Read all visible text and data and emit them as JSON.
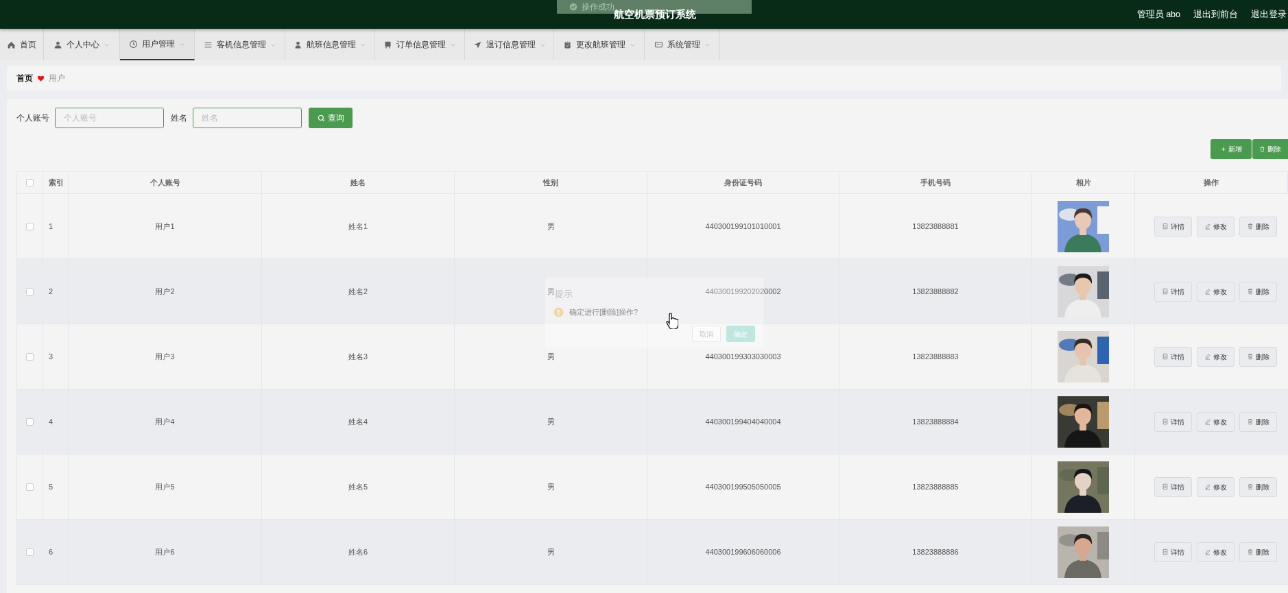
{
  "header": {
    "title": "航空机票预订系统",
    "user": "管理员 abo",
    "links": [
      "退出到前台",
      "退出登录"
    ]
  },
  "toast": {
    "text": "操作成功"
  },
  "nav": [
    {
      "label": "首页",
      "selected": false,
      "has_menu": false
    },
    {
      "label": "个人中心",
      "selected": false,
      "has_menu": true
    },
    {
      "label": "用户管理",
      "selected": true,
      "has_menu": true
    },
    {
      "label": "客机信息管理",
      "selected": false,
      "has_menu": true
    },
    {
      "label": "航班信息管理",
      "selected": false,
      "has_menu": true
    },
    {
      "label": "订单信息管理",
      "selected": false,
      "has_menu": true
    },
    {
      "label": "退订信息管理",
      "selected": false,
      "has_menu": true
    },
    {
      "label": "更改航班管理",
      "selected": false,
      "has_menu": true
    },
    {
      "label": "系统管理",
      "selected": false,
      "has_menu": true
    }
  ],
  "breadcrumb": [
    "首页",
    "用户"
  ],
  "search": {
    "fields": [
      {
        "label": "个人账号",
        "placeholder": "个人账号"
      },
      {
        "label": "姓名",
        "placeholder": "姓名"
      }
    ],
    "button": "查询"
  },
  "actions": [
    "新增",
    "删除"
  ],
  "table": {
    "select_all": {
      "checked": false
    },
    "columns": [
      "索引",
      "个人账号",
      "姓名",
      "性别",
      "身份证号码",
      "手机号码",
      "相片",
      "操作"
    ],
    "rows": [
      {
        "checked": false,
        "cells": [
          "1",
          "用户1",
          "姓名1",
          "男",
          "440300199101010001",
          "13823888881"
        ],
        "actions": [
          "详情",
          "修改",
          "删除"
        ]
      },
      {
        "checked": false,
        "cells": [
          "2",
          "用户2",
          "姓名2",
          "男",
          "440300199202020002",
          "13823888882"
        ],
        "actions": [
          "详情",
          "修改",
          "删除"
        ]
      },
      {
        "checked": false,
        "cells": [
          "3",
          "用户3",
          "姓名3",
          "男",
          "440300199303030003",
          "13823888883"
        ],
        "actions": [
          "详情",
          "修改",
          "删除"
        ]
      },
      {
        "checked": false,
        "cells": [
          "4",
          "用户4",
          "姓名4",
          "男",
          "440300199404040004",
          "13823888884"
        ],
        "actions": [
          "详情",
          "修改",
          "删除"
        ]
      },
      {
        "checked": false,
        "cells": [
          "5",
          "用户5",
          "姓名5",
          "男",
          "440300199505050005",
          "13823888885"
        ],
        "actions": [
          "详情",
          "修改",
          "删除"
        ]
      },
      {
        "checked": false,
        "cells": [
          "6",
          "用户6",
          "姓名6",
          "男",
          "440300199606060006",
          "13823888886"
        ],
        "actions": [
          "详情",
          "修改",
          "删除"
        ]
      }
    ]
  },
  "dialog": {
    "title": "提示",
    "message": "确定进行[删除]操作?",
    "buttons": [
      "取消",
      "确定"
    ]
  }
}
